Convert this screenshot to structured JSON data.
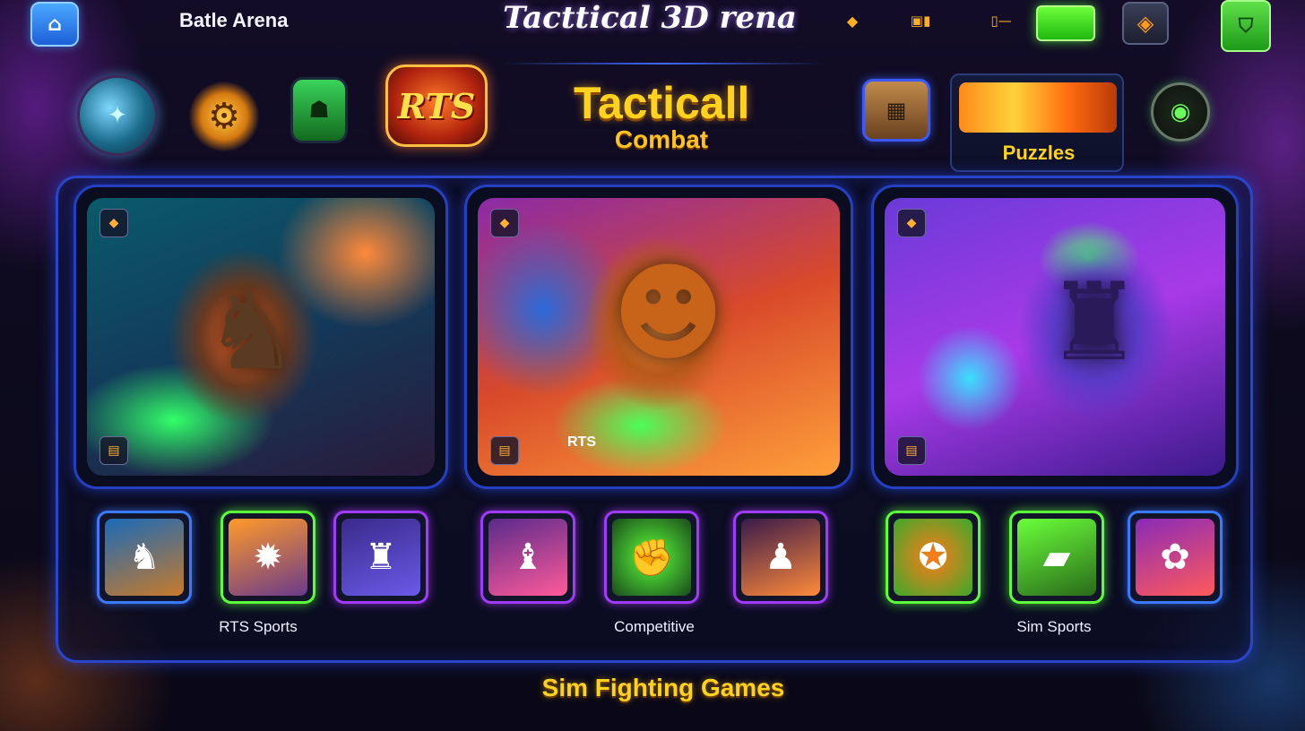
{
  "topbar": {
    "home_icon": "home-icon",
    "section_title": "Batle Arena",
    "logo_title": "Tacttical 3D rena",
    "icons": [
      "gem-icon",
      "card-icon",
      "coin-icon",
      "green-action-icon",
      "bag-icon",
      "shield-icon"
    ]
  },
  "categories": {
    "rts_label": "RTS",
    "featured_title": "Tacticall",
    "featured_subtitle": "Combat",
    "puzzles_label": "Puzzles"
  },
  "hero_cards": [
    {
      "name": "armored-warrior-card"
    },
    {
      "name": "bearded-hero-card",
      "tag": "RTS"
    },
    {
      "name": "mech-alien-card"
    }
  ],
  "groups": [
    {
      "label": "RTS Sports"
    },
    {
      "label": "Competitive"
    },
    {
      "label": "Sim Sports"
    }
  ],
  "footer": {
    "title": "Sim Fighting Games"
  },
  "colors": {
    "accent_yellow": "#ffd21e",
    "frame_blue": "#2a46c8",
    "highlight_green": "#5aff3a",
    "highlight_purple": "#a03aff"
  }
}
